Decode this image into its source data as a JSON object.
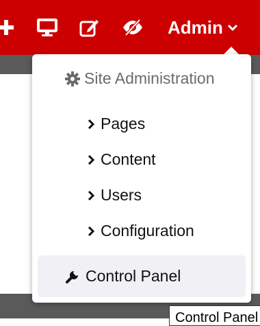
{
  "toolbar": {
    "add_icon": "plus-icon",
    "preview_icon": "monitor-icon",
    "edit_icon": "edit-icon",
    "visibility_icon": "eye-slash-icon",
    "admin_label": "Admin",
    "admin_caret_icon": "chevron-down-icon",
    "bg_color": "#cc0000"
  },
  "dropdown": {
    "header_icon": "gear-icon",
    "header_label": "Site Administration",
    "items": [
      {
        "label": "Pages",
        "icon": "chevron-right-icon"
      },
      {
        "label": "Content",
        "icon": "chevron-right-icon"
      },
      {
        "label": "Users",
        "icon": "chevron-right-icon"
      },
      {
        "label": "Configuration",
        "icon": "chevron-right-icon"
      }
    ],
    "control_panel": {
      "label": "Control Panel",
      "icon": "wrench-icon"
    }
  },
  "tooltip": {
    "text": "Control Panel"
  }
}
